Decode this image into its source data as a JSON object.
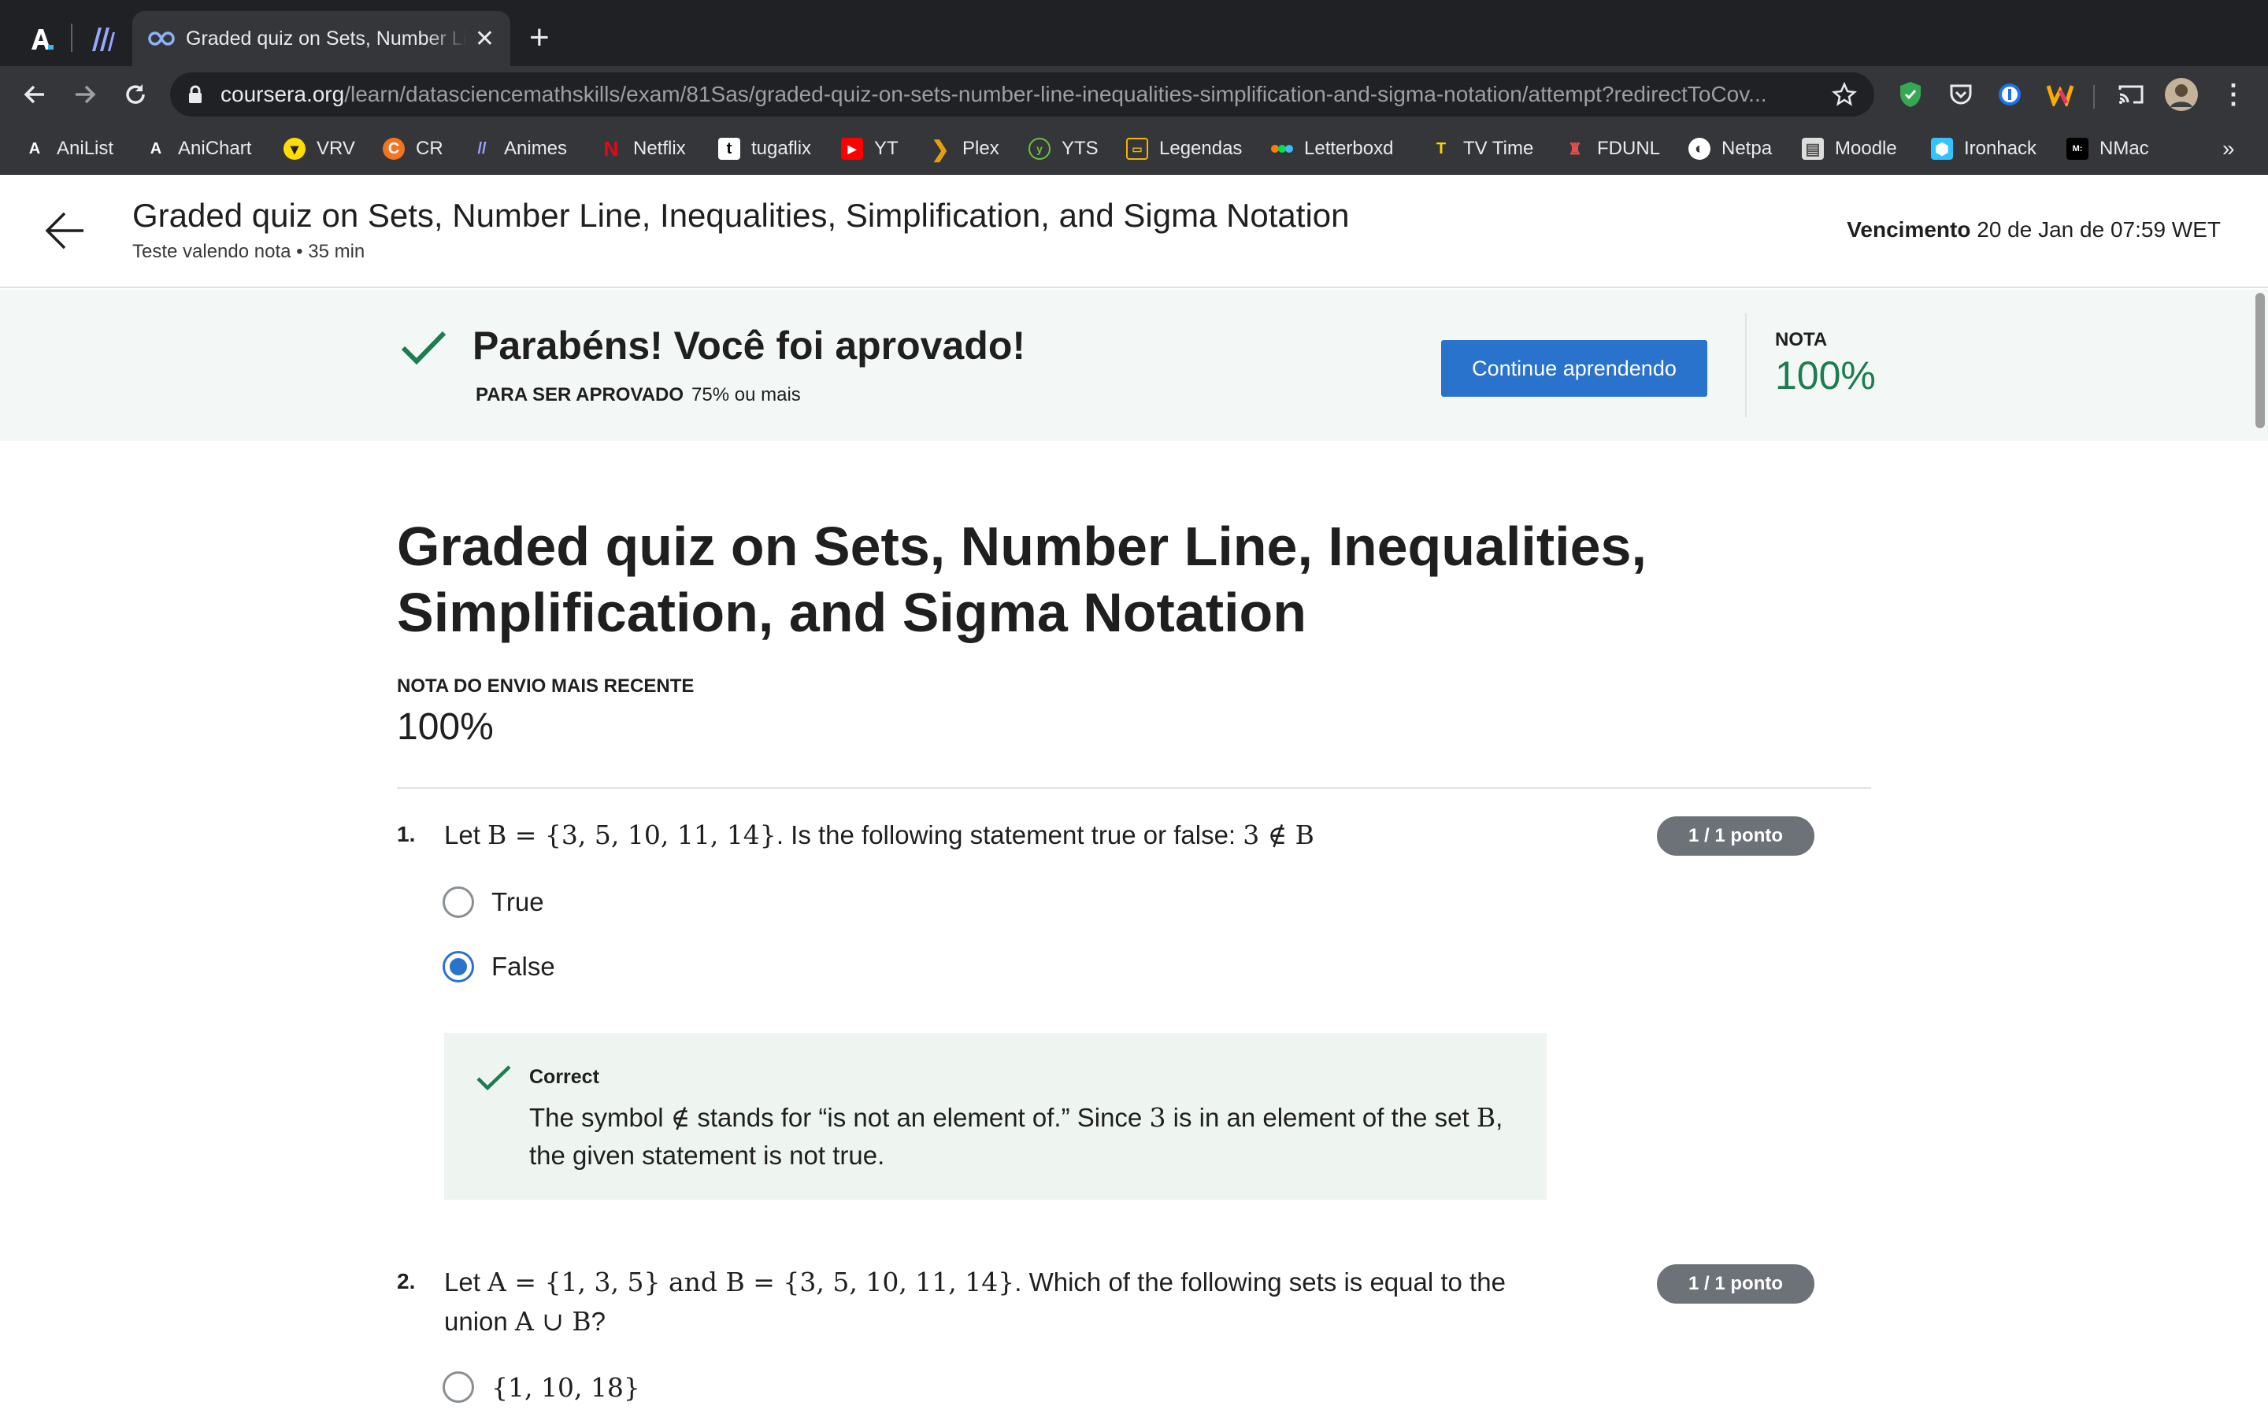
{
  "browser": {
    "tab_title": "Graded quiz on Sets, Number Line, Inequalities, Simplification, and Sigma Notation",
    "url_host": "coursera.org",
    "url_path": "/learn/datasciencemathskills/exam/81Sas/graded-quiz-on-sets-number-line-inequalities-simplification-and-sigma-notation/attempt?redirectToCov...",
    "bookmarks": [
      {
        "label": "AniList",
        "icon": "anilist-icon"
      },
      {
        "label": "AniChart",
        "icon": "anichart-icon"
      },
      {
        "label": "VRV",
        "icon": "vrv-icon"
      },
      {
        "label": "CR",
        "icon": "crunchyroll-icon"
      },
      {
        "label": "Animes",
        "icon": "animes-icon"
      },
      {
        "label": "Netflix",
        "icon": "netflix-icon"
      },
      {
        "label": "tugaflix",
        "icon": "tugaflix-icon"
      },
      {
        "label": "YT",
        "icon": "youtube-icon"
      },
      {
        "label": "Plex",
        "icon": "plex-icon"
      },
      {
        "label": "YTS",
        "icon": "yts-icon"
      },
      {
        "label": "Legendas",
        "icon": "legendas-icon"
      },
      {
        "label": "Letterboxd",
        "icon": "letterboxd-icon"
      },
      {
        "label": "TV Time",
        "icon": "tvtime-icon"
      },
      {
        "label": "FDUNL",
        "icon": "fdunl-icon"
      },
      {
        "label": "Netpa",
        "icon": "netpa-icon"
      },
      {
        "label": "Moodle",
        "icon": "moodle-icon"
      },
      {
        "label": "Ironhack",
        "icon": "ironhack-icon"
      },
      {
        "label": "NMac",
        "icon": "nmac-icon"
      }
    ],
    "more_bookmarks": "»"
  },
  "header": {
    "title": "Graded quiz on Sets, Number Line, Inequalities, Simplification, and Sigma Notation",
    "subtitle": "Teste valendo nota • 35 min",
    "due_label": "Vencimento",
    "due_value": "20 de Jan de 07:59 WET"
  },
  "banner": {
    "title": "Parabéns! Você foi aprovado!",
    "pass_label": "PARA SER APROVADO",
    "pass_value": "75% ou mais",
    "continue_label": "Continue aprendendo",
    "grade_label": "NOTA",
    "grade_value": "100%"
  },
  "main": {
    "title": "Graded quiz on Sets, Number Line, Inequalities, Simplification, and Sigma Notation",
    "recent_label": "NOTA DO ENVIO MAIS RECENTE",
    "recent_value": "100%"
  },
  "questions": [
    {
      "number": "1.",
      "points": "1 / 1 ponto",
      "text_a": "Let ",
      "math_a": "B = {3, 5, 10, 11, 14}",
      "text_b": ". Is the following statement true or false: ",
      "math_b": "3 ∉ B",
      "options": [
        {
          "label": "True",
          "selected": false
        },
        {
          "label": "False",
          "selected": true
        }
      ],
      "feedback": {
        "title": "Correct",
        "text_a": "The symbol ",
        "math_a": "∉",
        "text_b": " stands for “is not an element of.” Since ",
        "math_b": "3",
        "text_c": " is in an element of the set ",
        "math_c": "B",
        "text_d": ", the given statement is not true."
      }
    },
    {
      "number": "2.",
      "points": "1 / 1 ponto",
      "text_a": "Let ",
      "math_a": "A = {1, 3, 5}",
      "math_and": " and ",
      "math_b": "B = {3, 5, 10, 11, 14}",
      "text_b": ". Which of the following sets is equal to the union ",
      "math_c": "A ∪ B",
      "text_c": "?",
      "options": [
        {
          "label": "{1, 10, 18}",
          "selected": false
        }
      ]
    }
  ],
  "colors": {
    "accent_blue": "#2a73cc",
    "success_green": "#1d7c50",
    "banner_bg": "#f3f8f6",
    "feedback_bg": "#eef5f1",
    "points_pill": "#6d7278"
  }
}
